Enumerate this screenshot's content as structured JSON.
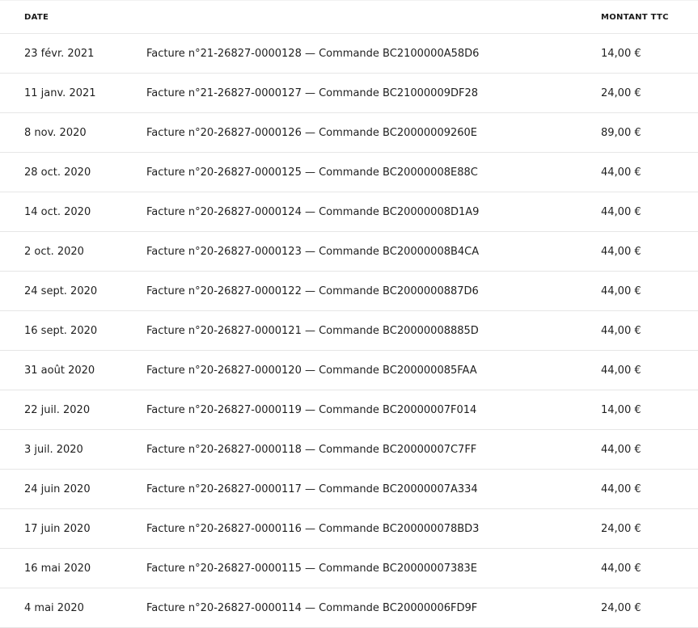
{
  "table": {
    "headers": {
      "date": "DATE",
      "description": "",
      "amount": "MONTANT TTC"
    },
    "rows": [
      {
        "date": "23 févr. 2021",
        "description": "Facture n°21-26827-0000128 — Commande BC2100000A58D6",
        "amount": "14,00 €"
      },
      {
        "date": "11 janv. 2021",
        "description": "Facture n°21-26827-0000127 — Commande BC21000009DF28",
        "amount": "24,00 €"
      },
      {
        "date": "8 nov. 2020",
        "description": "Facture n°20-26827-0000126 — Commande BC20000009260E",
        "amount": "89,00 €"
      },
      {
        "date": "28 oct. 2020",
        "description": "Facture n°20-26827-0000125 — Commande BC20000008E88C",
        "amount": "44,00 €"
      },
      {
        "date": "14 oct. 2020",
        "description": "Facture n°20-26827-0000124 — Commande BC20000008D1A9",
        "amount": "44,00 €"
      },
      {
        "date": "2 oct. 2020",
        "description": "Facture n°20-26827-0000123 — Commande BC20000008B4CA",
        "amount": "44,00 €"
      },
      {
        "date": "24 sept. 2020",
        "description": "Facture n°20-26827-0000122 — Commande BC2000000887D6",
        "amount": "44,00 €"
      },
      {
        "date": "16 sept. 2020",
        "description": "Facture n°20-26827-0000121 — Commande BC20000008885D",
        "amount": "44,00 €"
      },
      {
        "date": "31 août 2020",
        "description": "Facture n°20-26827-0000120 — Commande BC200000085FAA",
        "amount": "44,00 €"
      },
      {
        "date": "22 juil. 2020",
        "description": "Facture n°20-26827-0000119 — Commande BC20000007F014",
        "amount": "14,00 €"
      },
      {
        "date": "3 juil. 2020",
        "description": "Facture n°20-26827-0000118 — Commande BC20000007C7FF",
        "amount": "44,00 €"
      },
      {
        "date": "24 juin 2020",
        "description": "Facture n°20-26827-0000117 — Commande BC20000007A334",
        "amount": "44,00 €"
      },
      {
        "date": "17 juin 2020",
        "description": "Facture n°20-26827-0000116 — Commande BC200000078BD3",
        "amount": "24,00 €"
      },
      {
        "date": "16 mai 2020",
        "description": "Facture n°20-26827-0000115 — Commande BC20000007383E",
        "amount": "44,00 €"
      },
      {
        "date": "4 mai 2020",
        "description": "Facture n°20-26827-0000114 — Commande BC20000006FD9F",
        "amount": "24,00 €"
      }
    ]
  }
}
